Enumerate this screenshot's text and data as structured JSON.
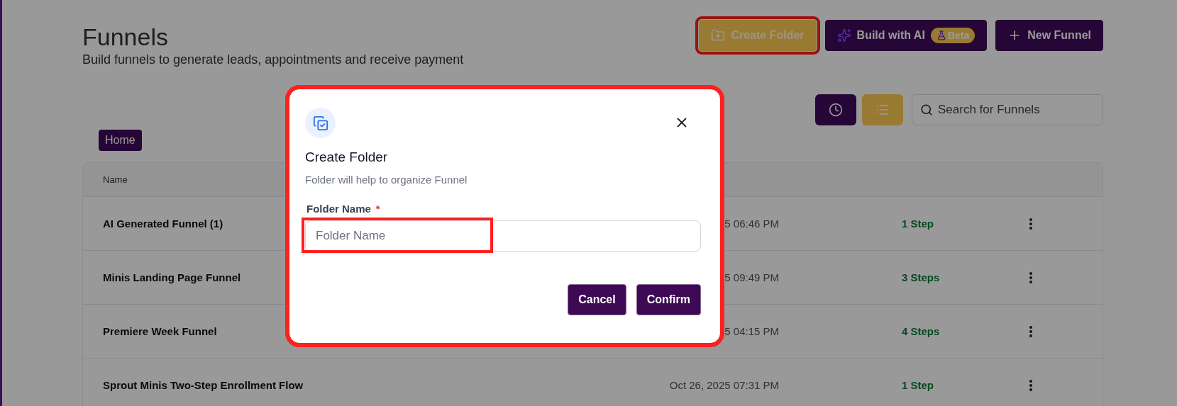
{
  "page": {
    "title": "Funnels",
    "subtitle": "Build funnels to generate leads, appointments and receive payment"
  },
  "header_buttons": [
    {
      "kind": "folder",
      "label": "Create Folder",
      "highlighted": true
    },
    {
      "kind": "ai",
      "label": "Build with AI",
      "badge": "Beta",
      "highlighted": false
    },
    {
      "kind": "new",
      "label": "New Funnel",
      "highlighted": false
    }
  ],
  "search": {
    "placeholder": "Search for Funnels"
  },
  "breadcrumb": [
    "Home"
  ],
  "table": {
    "columns": [
      "Name"
    ],
    "rows": [
      {
        "name": "AI Generated Funnel (1)",
        "date": "5 06:46 PM",
        "steps": "1 Step"
      },
      {
        "name": "Minis Landing Page Funnel",
        "date": "5 09:49 PM",
        "steps": "3 Steps"
      },
      {
        "name": "Premiere Week Funnel",
        "date": "5 04:15 PM",
        "steps": "4 Steps"
      },
      {
        "name": "Sprout Minis Two-Step Enrollment Flow",
        "date": "Oct 26, 2025 07:31 PM",
        "steps": "1 Step"
      }
    ]
  },
  "dialog": {
    "title": "Create Folder",
    "subtitle": "Folder will help to organize Funnel",
    "highlighted": true,
    "field": {
      "label": "Folder Name",
      "required_mark": "*",
      "placeholder": "Folder Name",
      "highlighted": true
    },
    "buttons": [
      {
        "label": "Cancel"
      },
      {
        "label": "Confirm"
      }
    ]
  }
}
